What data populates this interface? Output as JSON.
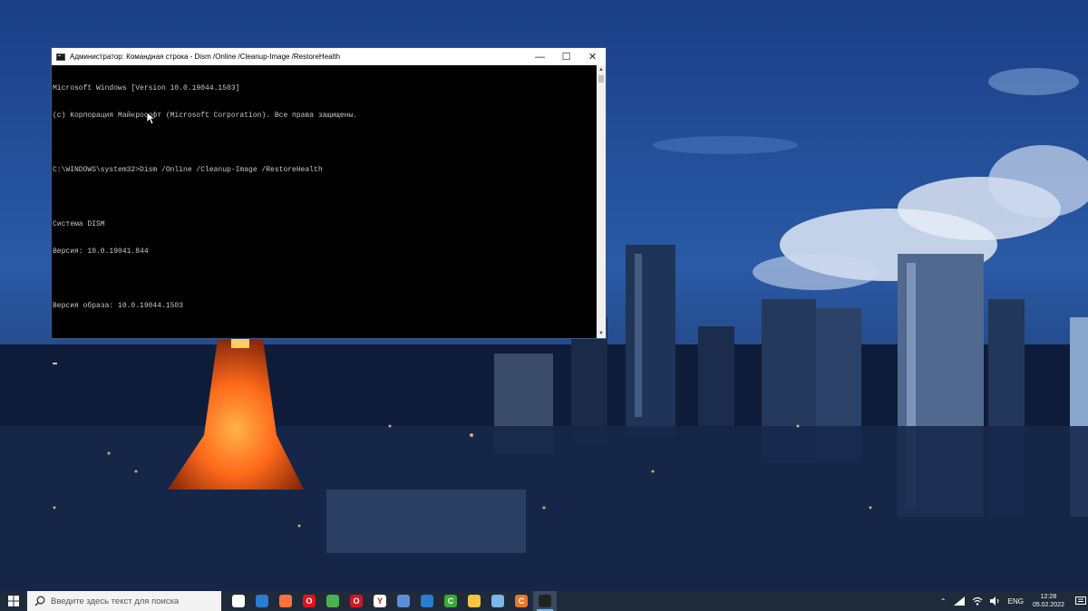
{
  "window": {
    "title": "Администратор: Командная строка - Dism  /Online /Cleanup-Image /RestoreHealth",
    "minimize_glyph": "—",
    "maximize_glyph": "☐",
    "close_glyph": "✕"
  },
  "console": {
    "lines": [
      "Microsoft Windows [Version 10.0.19044.1503]",
      "(c) Корпорация Майкрософт (Microsoft Corporation). Все права защищены.",
      "",
      "C:\\WINDOWS\\system32>Dism /Online /Cleanup-Image /RestoreHealth",
      "",
      "Система DISM",
      "Версия: 10.0.19041.844",
      "",
      "Версия образа: 10.0.19044.1503",
      "",
      ""
    ]
  },
  "taskbar": {
    "search_placeholder": "Введите здесь текст для поиска",
    "apps": [
      {
        "name": "file-icon",
        "label": "",
        "color": "#ffffff"
      },
      {
        "name": "mail-icon",
        "label": "",
        "color": "#2b7cd3"
      },
      {
        "name": "firefox-icon",
        "label": "",
        "color": "#ff7139"
      },
      {
        "name": "opera-icon",
        "label": "O",
        "color": "#e0141e"
      },
      {
        "name": "chrome-icon",
        "label": "",
        "color": "#4caf50"
      },
      {
        "name": "opera-gx-icon",
        "label": "O",
        "color": "#d1162a"
      },
      {
        "name": "yandex-browser-icon",
        "label": "Y",
        "color": "#ffffff"
      },
      {
        "name": "calculator-icon",
        "label": "",
        "color": "#5b8fd8"
      },
      {
        "name": "document-icon",
        "label": "",
        "color": "#2b7cd3"
      },
      {
        "name": "camtasia-icon",
        "label": "C",
        "color": "#3aaa35"
      },
      {
        "name": "folder-icon",
        "label": "",
        "color": "#f4c542"
      },
      {
        "name": "pen-tool-icon",
        "label": "",
        "color": "#7ab8e8"
      },
      {
        "name": "ccleaner-icon",
        "label": "C",
        "color": "#e8782a"
      },
      {
        "name": "terminal-icon",
        "label": "",
        "color": "#222222"
      }
    ],
    "tray": {
      "language": "ENG",
      "time": "12:28",
      "date": "05.02.2022"
    }
  }
}
